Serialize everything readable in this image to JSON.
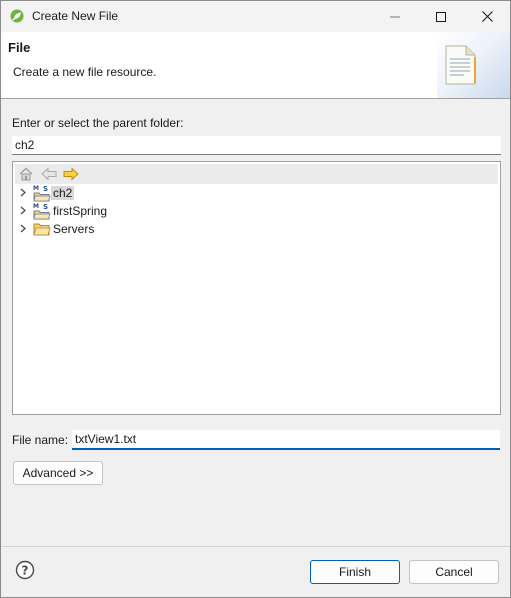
{
  "window": {
    "title": "Create New File"
  },
  "banner": {
    "title": "File",
    "description": "Create a new file resource."
  },
  "parent_folder": {
    "label": "Enter or select the parent folder:",
    "value": "ch2"
  },
  "tree": {
    "items": [
      {
        "label": "ch2",
        "icon": "maven-spring-project-icon",
        "selected": true
      },
      {
        "label": "firstSpring",
        "icon": "maven-spring-project-icon",
        "selected": false
      },
      {
        "label": "Servers",
        "icon": "folder-icon",
        "selected": false
      }
    ]
  },
  "file_name": {
    "label": "File name:",
    "value": "txtView1.txt"
  },
  "buttons": {
    "advanced": "Advanced >>",
    "finish": "Finish",
    "cancel": "Cancel"
  },
  "colors": {
    "accent": "#005fb8",
    "dialog_bg": "#f0f0f0"
  }
}
